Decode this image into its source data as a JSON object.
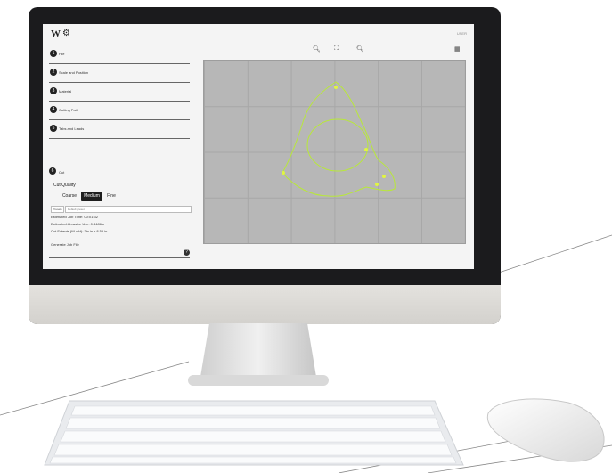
{
  "app": {
    "logo_text": "W",
    "user_label": "USER"
  },
  "sidebar": {
    "steps": [
      {
        "num": "1",
        "label": "File"
      },
      {
        "num": "2",
        "label": "Scale and Position"
      },
      {
        "num": "3",
        "label": "Material"
      },
      {
        "num": "4",
        "label": "Cutting Path"
      },
      {
        "num": "5",
        "label": "Tabs and Leads"
      }
    ],
    "cut": {
      "num": "6",
      "label": "Cut",
      "quality_label": "Cut Quality",
      "qualities": [
        "Coarse",
        "Medium",
        "Fine"
      ],
      "selected_quality": "Medium",
      "preset_label": "Presets",
      "preset_value": "Default preset",
      "estimates": [
        "Estimated Job Time: 00:01:32",
        "Estimated Abrasive Use: 0.348lbs",
        "Cut Extents (W x H): 3in in x 8.55 in"
      ],
      "generate_label": "Generate Job File",
      "help_icon": "question-icon"
    }
  },
  "toolbar": {
    "icons": [
      "zoom-in-icon",
      "fit-icon",
      "zoom-out-icon",
      "grid-icon"
    ]
  },
  "colors": {
    "path": "#b8e83a",
    "canvas": "#b7b7b7",
    "bezel": "#1b1b1d"
  }
}
